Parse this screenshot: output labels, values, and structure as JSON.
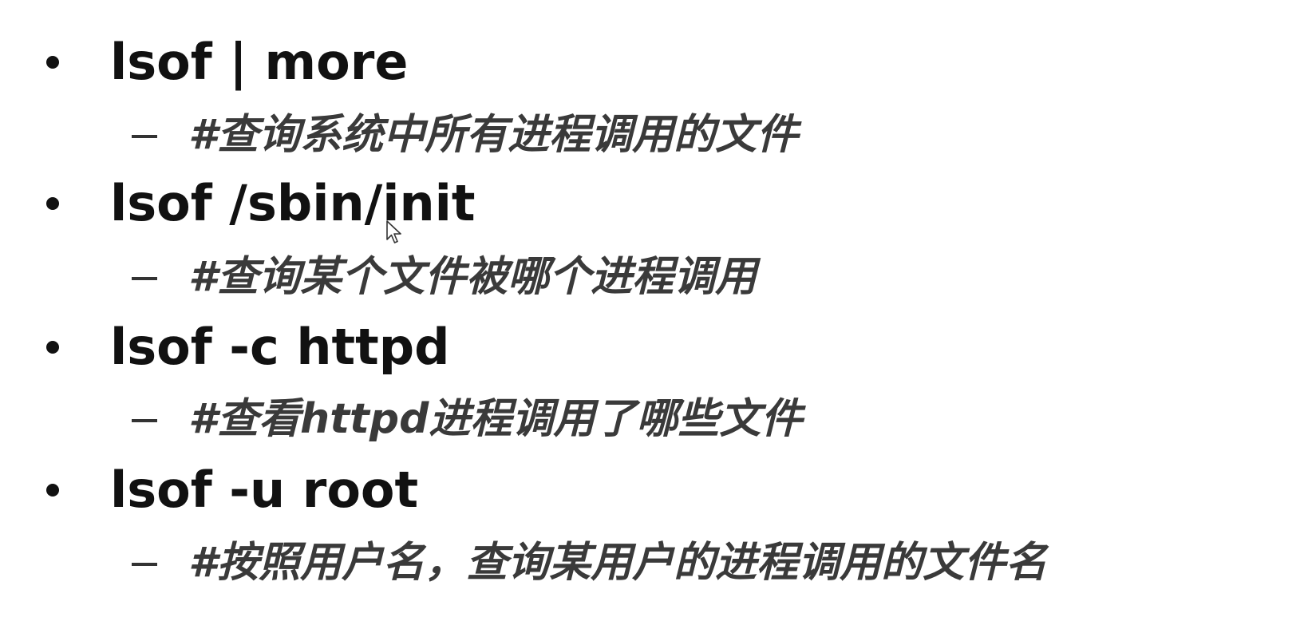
{
  "slide": {
    "items": [
      {
        "command": "lsof | more",
        "description": "#查询系统中所有进程调用的文件"
      },
      {
        "command": "lsof /sbin/init",
        "description": "#查询某个文件被哪个进程调用"
      },
      {
        "command": "lsof -c httpd",
        "description": "#查看httpd进程调用了哪些文件"
      },
      {
        "command": "lsof -u root",
        "description": "#按照用户名，查询某用户的进程调用的文件名"
      }
    ],
    "cursor_icon": "mouse-pointer-icon"
  }
}
